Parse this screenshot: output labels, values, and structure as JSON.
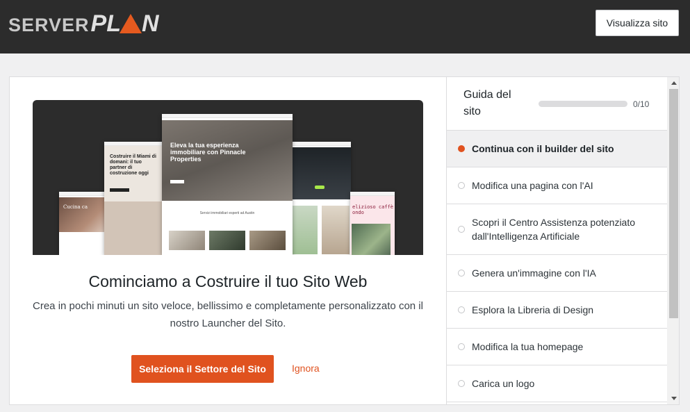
{
  "header": {
    "logo_part1": "SERVER",
    "logo_part2": "PL",
    "logo_part3": "N",
    "view_site_label": "Visualizza sito"
  },
  "hero": {
    "mockups": {
      "m1_text": "Cucina ca",
      "m2_text": "Costruire il Miami di domani: il tuo partner di costruzione oggi",
      "m3_title": "Eleva la tua esperienza immobiliare con Pinnacle Properties",
      "m3_sub": "Servizi immobiliari esperti ad Austin",
      "m5_text": "elizioso caffè ondo"
    }
  },
  "main": {
    "title": "Cominciamo a Costruire il tuo Sito Web",
    "description": "Crea in pochi minuti un sito veloce, bellissimo e completamente personalizzato con il nostro Launcher del Sito.",
    "primary_button": "Seleziona il Settore del Sito",
    "skip_link": "Ignora"
  },
  "guide": {
    "title": "Guida del sito",
    "progress_text": "0/10",
    "progress_fraction": 0,
    "items": [
      {
        "label": "Continua con il builder del sito",
        "active": true
      },
      {
        "label": "Modifica una pagina con l'AI",
        "active": false
      },
      {
        "label": "Scopri il Centro Assistenza potenziato dall'Intelligenza Artificiale",
        "active": false
      },
      {
        "label": "Genera un'immagine con l'IA",
        "active": false
      },
      {
        "label": "Esplora la Libreria di Design",
        "active": false
      },
      {
        "label": "Modifica la tua homepage",
        "active": false
      },
      {
        "label": "Carica un logo",
        "active": false
      }
    ]
  },
  "colors": {
    "accent": "#e0521f",
    "header_bg": "#2c2c2c"
  }
}
